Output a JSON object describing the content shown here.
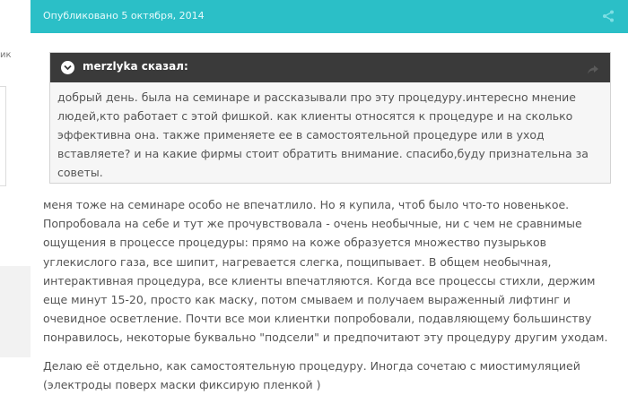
{
  "header": {
    "published": "Опубликовано 5 октября, 2014",
    "faint_label": "",
    "share_icon": "share-icon"
  },
  "left_stub": {
    "text": "ик"
  },
  "quote": {
    "author_title": "merzlyka сказал:",
    "icon": "chevron-down-circle-icon",
    "action_icon": "reply-arrow-icon",
    "text": "добрый день. была на семинаре и рассказывали про эту процедуру.интересно мнение людей,кто работает с этой фишкой. как клиенты относятся к процедуре и на сколько эффективна она. также применяете ее в самостоятельной процедуре или в уход вставляете? и на какие фирмы стоит обратить внимание. спасибо,буду признательна за советы."
  },
  "post": {
    "paragraph1": "меня тоже на семинаре особо не впечатлило. Но я купила, чтоб было что-то новенькое. Попробовала на себе и тут же прочувствовала - очень необычные, ни с чем не сравнимые ощущения в процессе процедуры: прямо на коже образуется множество пузырьков углекислого газа, все шипит, нагревается слегка, пощипывает. В общем необычная, интерактивная процедура, все клиенты впечатляются. Когда все процессы стихли, держим еще минут 15-20, просто как маску, потом смываем и получаем выраженный лифтинг и очевидное осветление. Почти все мои клиентки попробовали, подавляющему большинству понравилось, некоторые буквально \"подсели\" и предпочитают эту процедуру другим уходам.",
    "paragraph2": "Делаю её отдельно, как самостоятельную процедуру. Иногда сочетаю с миостимуляцией (электроды поверх маски фиксирую пленкой )"
  },
  "colors": {
    "header_bg": "#2bbfc7",
    "quote_head_bg": "#3a3a3a",
    "quote_bg": "#f6f6f6",
    "text": "#555555"
  }
}
